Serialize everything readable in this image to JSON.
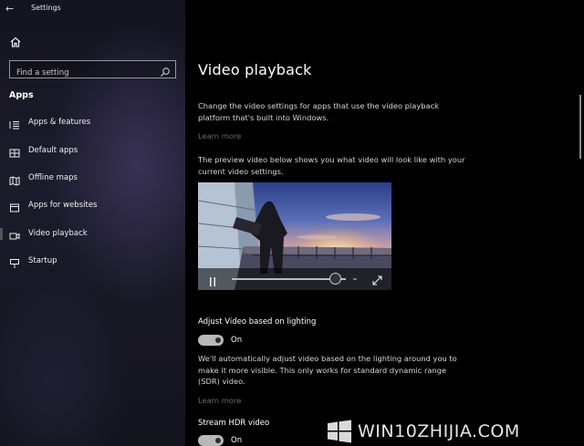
{
  "window": {
    "title": "Settings",
    "controls": {
      "minimize": "–",
      "maximize": "☐",
      "close": "✕"
    }
  },
  "sidebar": {
    "search": {
      "placeholder": "Find a setting",
      "value": ""
    },
    "section_title": "Apps",
    "items": [
      {
        "label": "Apps & features",
        "icon": "list-icon"
      },
      {
        "label": "Default apps",
        "icon": "default-apps-icon"
      },
      {
        "label": "Offline maps",
        "icon": "map-icon"
      },
      {
        "label": "Apps for websites",
        "icon": "web-apps-icon"
      },
      {
        "label": "Video playback",
        "icon": "video-icon",
        "selected": true
      },
      {
        "label": "Startup",
        "icon": "startup-icon"
      }
    ]
  },
  "main": {
    "title": "Video playback",
    "intro": "Change the video settings for apps that use the video playback platform that's built into Windows.",
    "learn_more_1": "Learn more",
    "preview_text": "The preview video below shows you what video will look like with your current video settings.",
    "video": {
      "progress": 0.85
    },
    "adjust_lighting": {
      "label": "Adjust Video based on lighting",
      "state": "On",
      "description": "We'll automatically adjust video based on the lighting around you to make it more visible. This only works for standard dynamic range (SDR) video.",
      "learn_more": "Learn more"
    },
    "hdr": {
      "label": "Stream HDR video",
      "state": "On"
    }
  },
  "watermark": {
    "text": "WIN10ZHIJIA.COM"
  },
  "colors": {
    "accent": "#b8b8b8",
    "link": "#6b6b6b",
    "background": "#000000"
  }
}
